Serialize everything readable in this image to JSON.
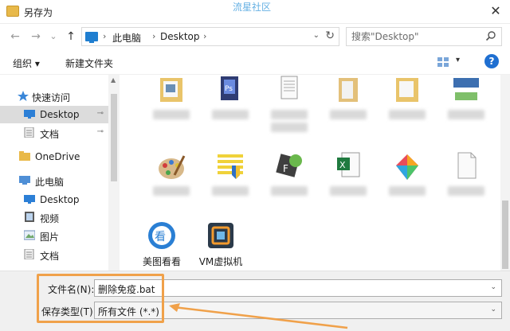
{
  "window": {
    "title": "另存为",
    "watermark": "流星社区",
    "close_glyph": "✕"
  },
  "nav": {
    "back_glyph": "←",
    "forward_glyph": "→",
    "recent_glyph": "⌄",
    "up_glyph": "↑",
    "breadcrumb": [
      "此电脑",
      "Desktop"
    ],
    "crumb_separator": "›",
    "dropdown_glyph": "⌄",
    "refresh_glyph": "↻",
    "search_placeholder": "搜索\"Desktop\""
  },
  "toolbar": {
    "organize": "组织 ▾",
    "new_folder": "新建文件夹",
    "view_dropdown_glyph": "▾",
    "help_glyph": "?"
  },
  "sidebar": {
    "items": [
      {
        "label": "快速访问",
        "icon": "star-icon"
      },
      {
        "label": "Desktop",
        "icon": "desktop-icon",
        "pinned": true,
        "selected": true
      },
      {
        "label": "文档",
        "icon": "documents-icon",
        "pinned": true
      },
      {
        "label": "OneDrive",
        "icon": "onedrive-folder-icon"
      },
      {
        "label": "此电脑",
        "icon": "this-pc-icon"
      },
      {
        "label": "Desktop",
        "icon": "desktop-icon"
      },
      {
        "label": "视频",
        "icon": "videos-icon"
      },
      {
        "label": "图片",
        "icon": "pictures-icon"
      },
      {
        "label": "文档",
        "icon": "documents-icon"
      }
    ],
    "pin_glyph": "📌",
    "scroll_up_glyph": "▲"
  },
  "files": {
    "labeled": [
      {
        "name": "美图看看"
      },
      {
        "name": "VM虚拟机"
      }
    ]
  },
  "form": {
    "filename_label": "文件名(N):",
    "filename_value": "删除免疫.bat",
    "filetype_label": "保存类型(T):",
    "filetype_value": "所有文件  (*.*)",
    "dropdown_glyph": "⌄"
  },
  "colors": {
    "accent": "#1f6fd1",
    "highlight": "#f0a14a",
    "watermark": "#4aa3df"
  }
}
